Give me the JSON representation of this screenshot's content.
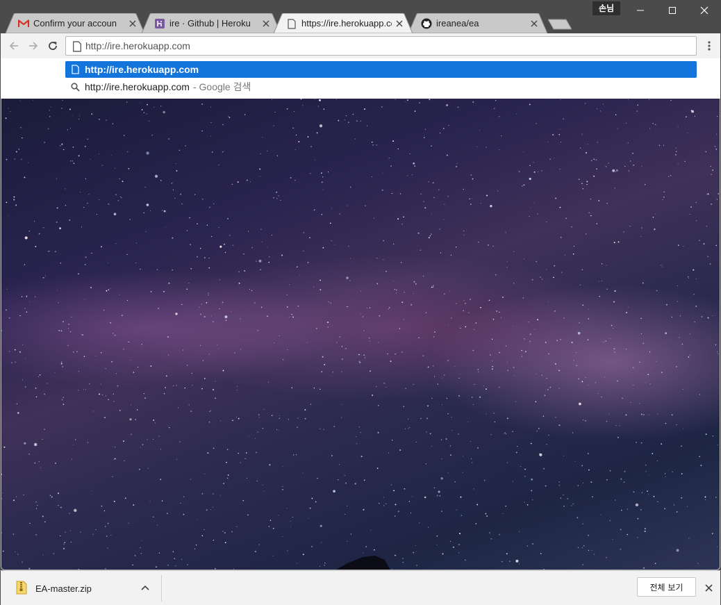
{
  "window": {
    "profile_label": "손님"
  },
  "tabs": [
    {
      "title": "Confirm your account o",
      "favicon": "gmail-icon",
      "active": false
    },
    {
      "title": "ire · Github | Heroku",
      "favicon": "heroku-icon",
      "active": false
    },
    {
      "title": "https://ire.herokuapp.co",
      "favicon": "page-icon",
      "active": true
    },
    {
      "title": "ireanea/ea",
      "favicon": "github-icon",
      "active": false
    }
  ],
  "toolbar": {
    "address_value": "http://ire.herokuapp.com",
    "back_icon": "back-arrow-icon",
    "forward_icon": "forward-arrow-icon",
    "reload_icon": "reload-icon",
    "menu_icon": "kebab-menu-icon"
  },
  "omnibox_suggestions": [
    {
      "text": "http://ire.herokuapp.com",
      "suffix": "",
      "icon": "page-icon"
    },
    {
      "text": "http://ire.herokuapp.com",
      "suffix": "- Google 검색",
      "icon": "search-icon"
    }
  ],
  "downloads": {
    "items": [
      {
        "filename": "EA-master.zip",
        "icon": "zip-file-icon"
      }
    ],
    "show_all_label": "전체 보기"
  },
  "colors": {
    "chrome_frame": "#4b4b4b",
    "toolbar_bg": "#f2f2f2",
    "selection_blue": "#1374dc"
  }
}
